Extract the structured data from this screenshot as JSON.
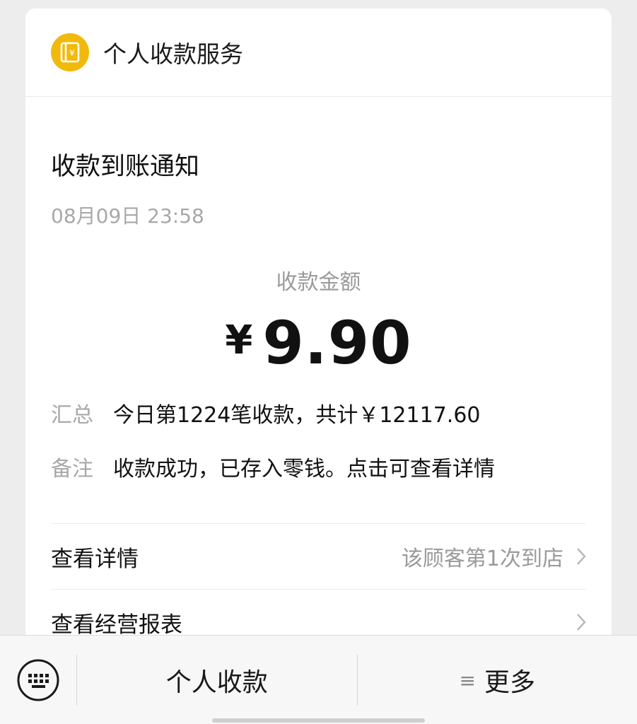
{
  "service": {
    "name": "个人收款服务",
    "icon": "wallet-yen-icon",
    "icon_color": "#f1b90b",
    "icon_glyph": "¥"
  },
  "notice": {
    "title": "收款到账通知",
    "time": "08月09日 23:58",
    "amount_label": "收款金额",
    "currency": "¥",
    "amount": "9.90",
    "summary_label": "汇总",
    "summary_value": "今日第1224笔收款，共计￥12117.60",
    "remark_label": "备注",
    "remark_value": "收款成功，已存入零钱。点击可查看详情"
  },
  "links": [
    {
      "label": "查看详情",
      "hint": "该顾客第1次到店",
      "icon": "chevron-right-icon"
    },
    {
      "label": "查看经营报表",
      "hint": "",
      "icon": "chevron-right-icon"
    }
  ],
  "bottom_bar": {
    "keyboard_icon": "keyboard-icon",
    "menu1": "个人收款",
    "menu2_icon": "≡",
    "menu2": "更多"
  }
}
